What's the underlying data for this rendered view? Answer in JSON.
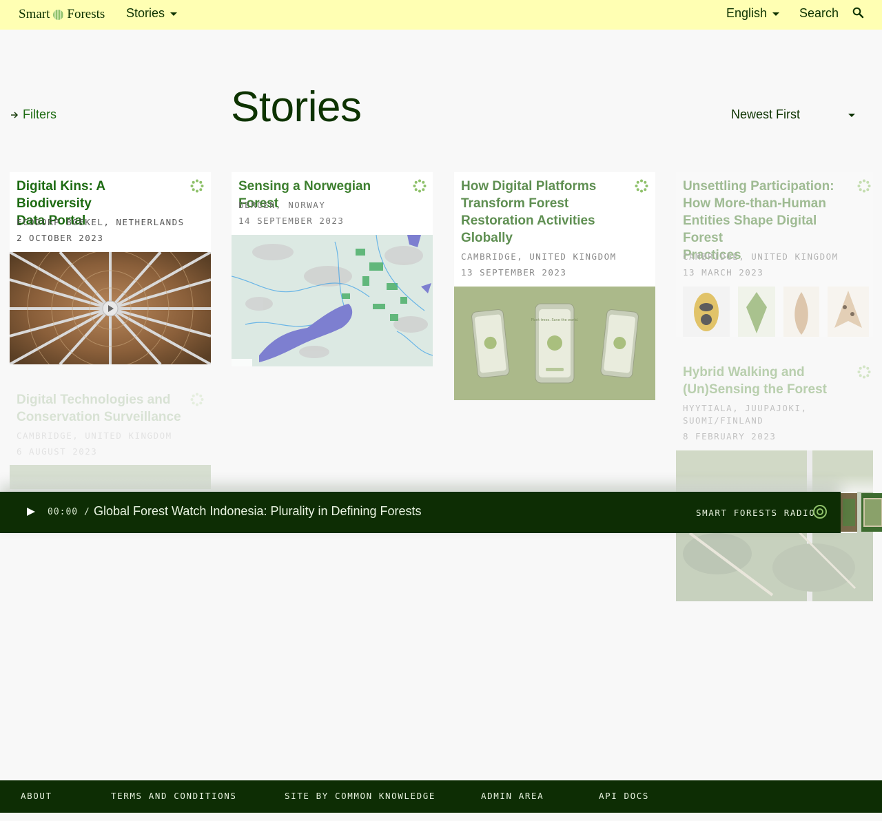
{
  "nav": {
    "logo_left": "Smart",
    "logo_right": "Forests",
    "stories_label": "Stories",
    "language_label": "English",
    "search_label": "Search"
  },
  "header": {
    "filters_label": "Filters",
    "title": "Stories",
    "sort_label": "Newest First"
  },
  "cards": [
    {
      "title_lines": [
        "Digital Kins: A Biodiversity",
        "Data Portal"
      ],
      "location": "ECODORP BOEKEL, NETHERLANDS",
      "date": "2 OCTOBER 2023",
      "thumb_icon": "lattice-roof-image"
    },
    {
      "title_lines": [
        "Sensing a Norwegian Forest"
      ],
      "location": "BERGEN, NORWAY",
      "date": "14 SEPTEMBER 2023",
      "thumb_icon": "map-image"
    },
    {
      "title_lines": [
        "How Digital Platforms",
        "Transform Forest",
        "Restoration Activities",
        "Globally"
      ],
      "location": "CAMBRIDGE, UNITED KINGDOM",
      "date": "13 SEPTEMBER 2023",
      "thumb_icon": "phones-image",
      "phone_text": "Plant trees. Save the world."
    },
    {
      "title_lines": [
        "Unsettling Participation:",
        "How More-than-Human",
        "Entities Shape Digital Forest",
        "Practices"
      ],
      "location": "CAMBRIDGE, UNITED KINGDOM",
      "date": "13 MARCH 2023",
      "thumb_icon": "insects-image"
    },
    {
      "title_lines": [
        "Digital Technologies and",
        "Conservation Surveillance"
      ],
      "location": "CAMBRIDGE, UNITED KINGDOM",
      "date": "6 AUGUST 2023",
      "thumb_icon": "forest-image"
    },
    {
      "title_lines": [
        "Hybrid Walking and",
        "(Un)Sensing the Forest"
      ],
      "location_lines": [
        "HYYTIALA, JUUPAJOKI,",
        "SUOMI/FINLAND"
      ],
      "date": "8 FEBRUARY 2023",
      "thumb_icon": "forest-floor-image"
    }
  ],
  "player": {
    "time": "00:00 /",
    "title": "Global Forest Watch Indonesia: Plurality in Defining Forests",
    "radio_label": "SMART FORESTS RADIO"
  },
  "footer": {
    "links": [
      "ABOUT",
      "TERMS AND CONDITIONS",
      "SITE BY COMMON KNOWLEDGE",
      "ADMIN AREA",
      "API DOCS"
    ]
  },
  "colors": {
    "topbar": "#ffffb3",
    "dark_green": "#0d2d04",
    "link_green": "#1d6b12",
    "accent_green": "#8fc16b",
    "background": "#f8f8f8"
  }
}
